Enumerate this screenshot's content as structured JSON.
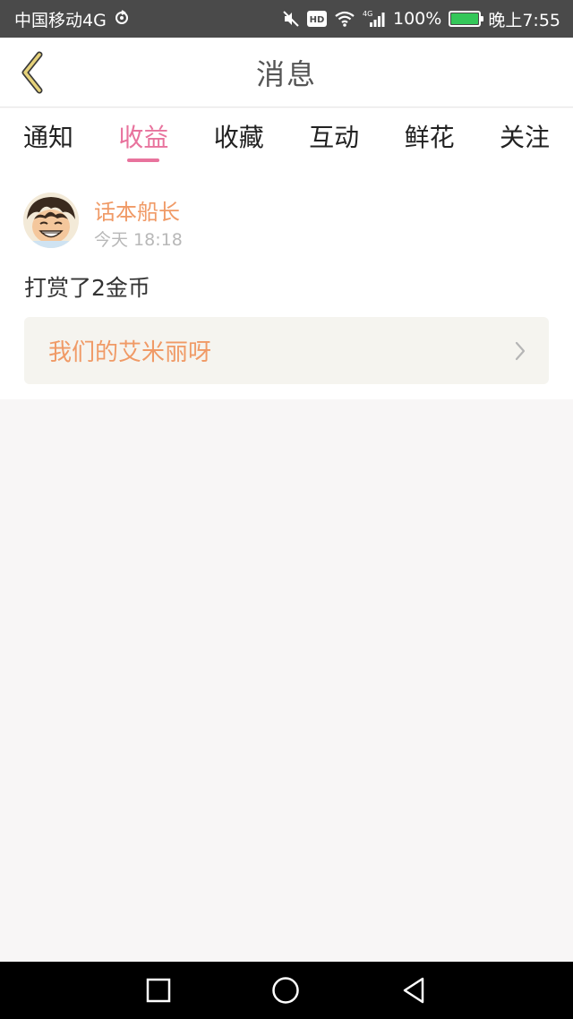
{
  "status_bar": {
    "carrier": "中国移动4G",
    "network": "4G",
    "battery": "100%",
    "time": "晚上7:55",
    "hd_label": "HD"
  },
  "header": {
    "title": "消息",
    "back_icon": "chevron-left-icon",
    "accent_color": "#c9b46b"
  },
  "tabs": [
    {
      "label": "通知",
      "active": false
    },
    {
      "label": "收益",
      "active": true
    },
    {
      "label": "收藏",
      "active": false
    },
    {
      "label": "互动",
      "active": false
    },
    {
      "label": "鲜花",
      "active": false
    },
    {
      "label": "关注",
      "active": false
    }
  ],
  "active_tab_color": "#e8739d",
  "message": {
    "user_name": "话本船长",
    "time": "今天 18:18",
    "text": "打赏了2金币",
    "link_title": "我们的艾米丽呀",
    "name_color": "#f09a66"
  },
  "nav_bar": {
    "recent_icon": "square-icon",
    "home_icon": "circle-icon",
    "back_icon": "triangle-back-icon"
  }
}
